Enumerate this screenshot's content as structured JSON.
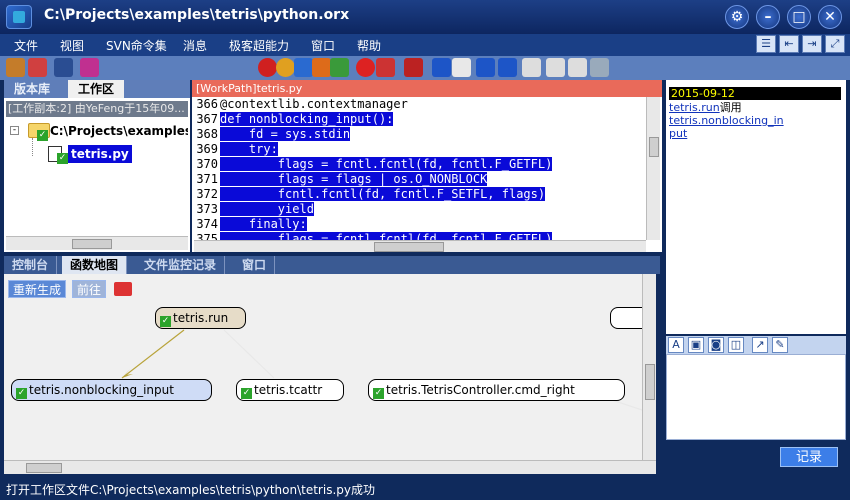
{
  "window": {
    "title": "C:\\Projects\\examples\\tetris\\python.orx"
  },
  "menu": [
    "文件",
    "视图",
    "SVN命令集",
    "消息",
    "极客超能力",
    "窗口",
    "帮助"
  ],
  "left_tabs": [
    "版本库",
    "工作区"
  ],
  "working_copy_header": "[工作副本:2] 由YeFeng于15年09...",
  "tree": {
    "root": "C:\\Projects\\examples\\tetr",
    "file": "tetris.py"
  },
  "editor": {
    "title": "[WorkPath]tetris.py",
    "lines": [
      {
        "n": "366",
        "text": "@contextlib.contextmanager",
        "sel": false
      },
      {
        "n": "367",
        "text": "def nonblocking_input():",
        "sel": true
      },
      {
        "n": "368",
        "text": "    fd = sys.stdin",
        "sel": true
      },
      {
        "n": "369",
        "text": "    try:",
        "sel": true
      },
      {
        "n": "370",
        "text": "        flags = fcntl.fcntl(fd, fcntl.F_GETFL)",
        "sel": true
      },
      {
        "n": "371",
        "text": "        flags = flags | os.O_NONBLOCK",
        "sel": true
      },
      {
        "n": "372",
        "text": "        fcntl.fcntl(fd, fcntl.F_SETFL, flags)",
        "sel": true
      },
      {
        "n": "373",
        "text": "        yield",
        "sel": true
      },
      {
        "n": "374",
        "text": "    finally:",
        "sel": true
      },
      {
        "n": "375",
        "text": "        flags = fcntl.fcntl(fd, fcntl.F_GETFL)",
        "sel": true
      }
    ]
  },
  "log": {
    "date": "2015-09-12",
    "caller": "tetris.run",
    "verb": "调用",
    "callee": "tetris.nonblocking_in",
    "callee_cont": "put"
  },
  "bottom_tabs": [
    "控制台",
    "函数地图",
    "文件监控记录",
    "窗口"
  ],
  "graph": {
    "regenerate": "重新生成",
    "forward": "前往",
    "nodes": {
      "run": "tetris.run",
      "nonblocking": "tetris.nonblocking_input",
      "tcattr": "tetris.tcattr",
      "cmd_right": "tetris.TetrisController.cmd_right"
    }
  },
  "record_button": "记录",
  "status": "打开工作区文件C:\\Projects\\examples\\tetris\\python\\tetris.py成功",
  "colors": {
    "accent": "#1a3f86",
    "selection": "#0a0ad8",
    "node_root": "#e6dcc8",
    "node_active": "#cfdcf6"
  }
}
